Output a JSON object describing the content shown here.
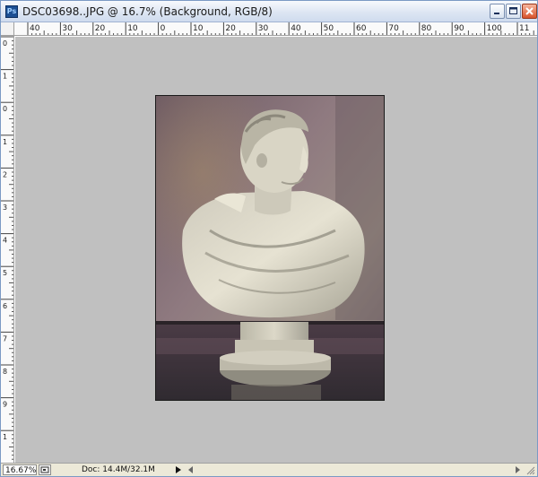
{
  "window": {
    "title": "DSC03698..JPG @ 16.7% (Background, RGB/8)",
    "app_icon_text": "Ps",
    "title_icon": "photoshop-document-icon"
  },
  "window_controls": {
    "minimize_icon": "minimize-icon",
    "maximize_icon": "maximize-icon",
    "close_icon": "close-icon"
  },
  "rulers": {
    "top_labels": [
      "40",
      "30",
      "20",
      "10",
      "0",
      "10",
      "20",
      "30",
      "40",
      "50",
      "60",
      "70",
      "80",
      "90",
      "100",
      "11"
    ],
    "left_labels": [
      "0",
      "1",
      "0",
      "1",
      "2",
      "3",
      "4",
      "5",
      "6",
      "7",
      "8",
      "9",
      "1"
    ]
  },
  "canvas": {
    "image": "marble-bust-photo",
    "background_color": "#c0c0c0"
  },
  "statusbar": {
    "zoom": "16.67%",
    "doc_info": "Doc: 14.4M/32.1M",
    "menu_arrow_icon": "right-triangle-icon"
  }
}
